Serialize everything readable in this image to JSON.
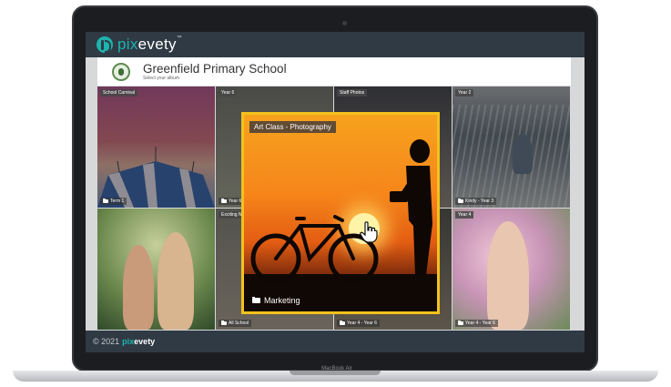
{
  "device": {
    "model": "MacBook Air"
  },
  "app": {
    "brand_prefix": "pix",
    "brand_suffix": "evety",
    "brand_mark": "™",
    "accent_color": "#1db4ad",
    "header_color": "#2f3a45"
  },
  "school": {
    "name": "Greenfield Primary School",
    "subtitle": "Select your album",
    "logo_icon": "school-crest-icon"
  },
  "albums": [
    {
      "label": "School Carnival",
      "footer": "Term 1"
    },
    {
      "label": "Year 6",
      "footer": "Year 6"
    },
    {
      "label": "Staff Photos",
      "footer": ""
    },
    {
      "label": "Year 2",
      "footer": "Kindy - Year 3"
    },
    {
      "label": "",
      "footer": ""
    },
    {
      "label": "Exciting N...",
      "footer": "All School"
    },
    {
      "label": "",
      "footer": "Year 4 - Year 6"
    },
    {
      "label": "Year 4",
      "footer": "Year 4 - Year 6"
    }
  ],
  "featured": {
    "label": "Art Class - Photography",
    "footer": "Marketing",
    "border_color": "#f3c21b"
  },
  "footer": {
    "copyright": "© 2021",
    "brand_prefix": "pix",
    "brand_suffix": "evety"
  }
}
